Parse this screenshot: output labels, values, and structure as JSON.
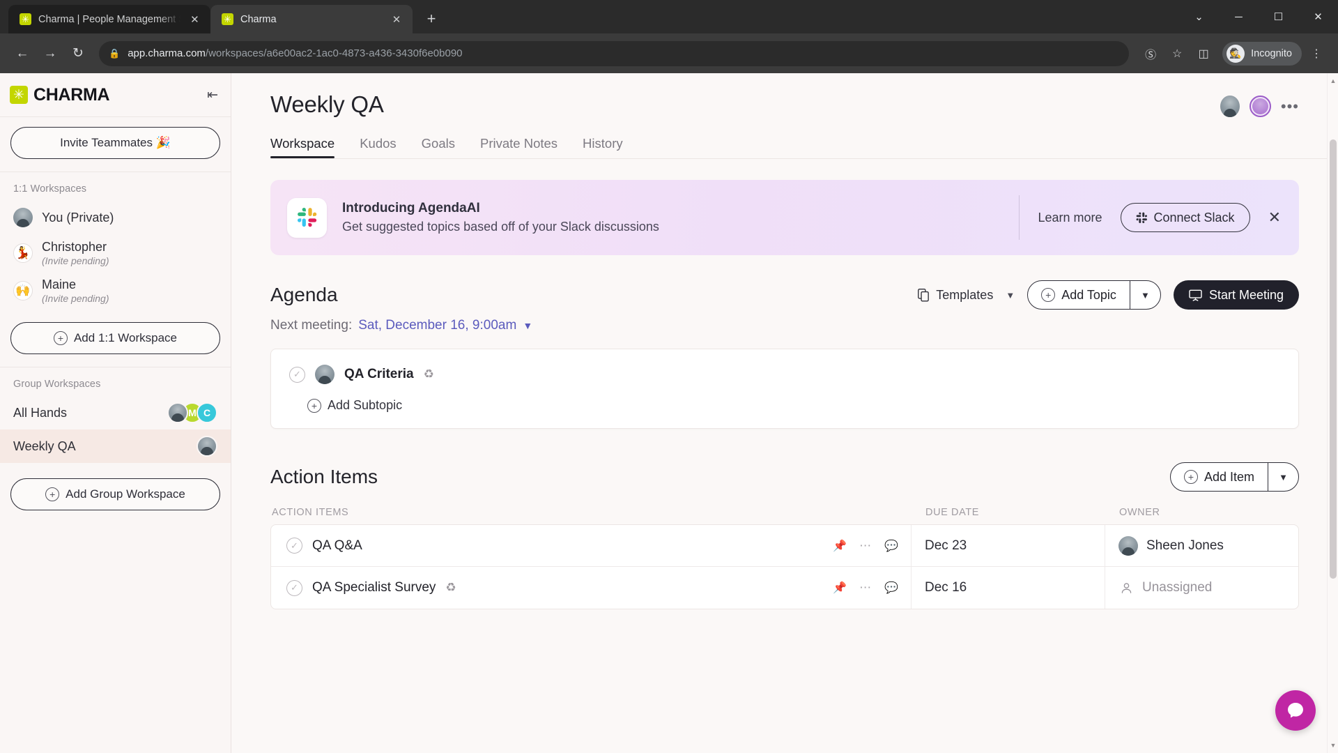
{
  "browser": {
    "tabs": [
      {
        "title": "Charma | People Management S",
        "favicon": "charma-favicon",
        "active": false
      },
      {
        "title": "Charma",
        "favicon": "charma-favicon",
        "active": true
      }
    ],
    "new_tab_label": "+",
    "window_controls": {
      "minimize": "—",
      "maximize": "☐",
      "close": "✕",
      "more": "⌄"
    },
    "nav": {
      "back": "←",
      "forward": "→",
      "reload": "↻"
    },
    "url_host": "app.charma.com",
    "url_path": "/workspaces/a6e00ac2-1ac0-4873-a436-3430f6e0b090",
    "lock_icon": "🔒",
    "profile_label": "Incognito"
  },
  "sidebar": {
    "logo_text": "CHARMA",
    "collapse_label": "⇤",
    "invite_button": "Invite Teammates 🎉",
    "section_1_label": "1:1 Workspaces",
    "one_on_one": [
      {
        "name": "You (Private)",
        "sub": "",
        "avatar": "photo"
      },
      {
        "name": "Christopher",
        "sub": "(Invite pending)",
        "avatar": "👤"
      },
      {
        "name": "Maine",
        "sub": "(Invite pending)",
        "avatar": "🙌"
      }
    ],
    "add_one_on_one": "Add 1:1 Workspace",
    "section_2_label": "Group Workspaces",
    "groups": [
      {
        "name": "All Hands",
        "selected": false,
        "avatars": [
          "photo",
          "M",
          "C"
        ]
      },
      {
        "name": "Weekly QA",
        "selected": true,
        "avatars": [
          "photo"
        ]
      }
    ],
    "add_group": "Add Group Workspace"
  },
  "header": {
    "title": "Weekly QA",
    "more_label": "•••",
    "tabs": [
      {
        "label": "Workspace",
        "active": true
      },
      {
        "label": "Kudos",
        "active": false
      },
      {
        "label": "Goals",
        "active": false
      },
      {
        "label": "Private Notes",
        "active": false
      },
      {
        "label": "History",
        "active": false
      }
    ]
  },
  "banner": {
    "icon": "slack-icon",
    "title": "Introducing AgendaAI",
    "subtitle": "Get suggested topics based off of your Slack discussions",
    "learn_more": "Learn more",
    "connect_button": "Connect Slack",
    "close_label": "✕"
  },
  "agenda": {
    "title": "Agenda",
    "templates_label": "Templates",
    "add_topic_label": "Add Topic",
    "start_meeting_label": "Start Meeting",
    "next_meeting_label": "Next meeting:",
    "next_meeting_value": "Sat, December 16, 9:00am",
    "topics": [
      {
        "name": "QA Criteria",
        "avatar": "photo",
        "recurring": true
      }
    ],
    "add_subtopic_label": "Add Subtopic"
  },
  "action_items": {
    "title": "Action Items",
    "add_item_label": "Add Item",
    "columns": [
      "ACTION ITEMS",
      "DUE DATE",
      "OWNER"
    ],
    "rows": [
      {
        "name": "QA Q&A",
        "recurring": false,
        "due_date": "Dec 23",
        "owner": "Sheen Jones",
        "owner_assigned": true
      },
      {
        "name": "QA Specialist Survey",
        "recurring": true,
        "due_date": "Dec 16",
        "owner": "Unassigned",
        "owner_assigned": false
      }
    ]
  },
  "support": {
    "launcher": "intercom-launcher"
  },
  "colors": {
    "brand_green": "#c3d600",
    "accent_purple": "#5b5bbd",
    "selected_row": "#f6e9e4",
    "intercom": "#c026a4",
    "dark_button": "#21212b"
  }
}
